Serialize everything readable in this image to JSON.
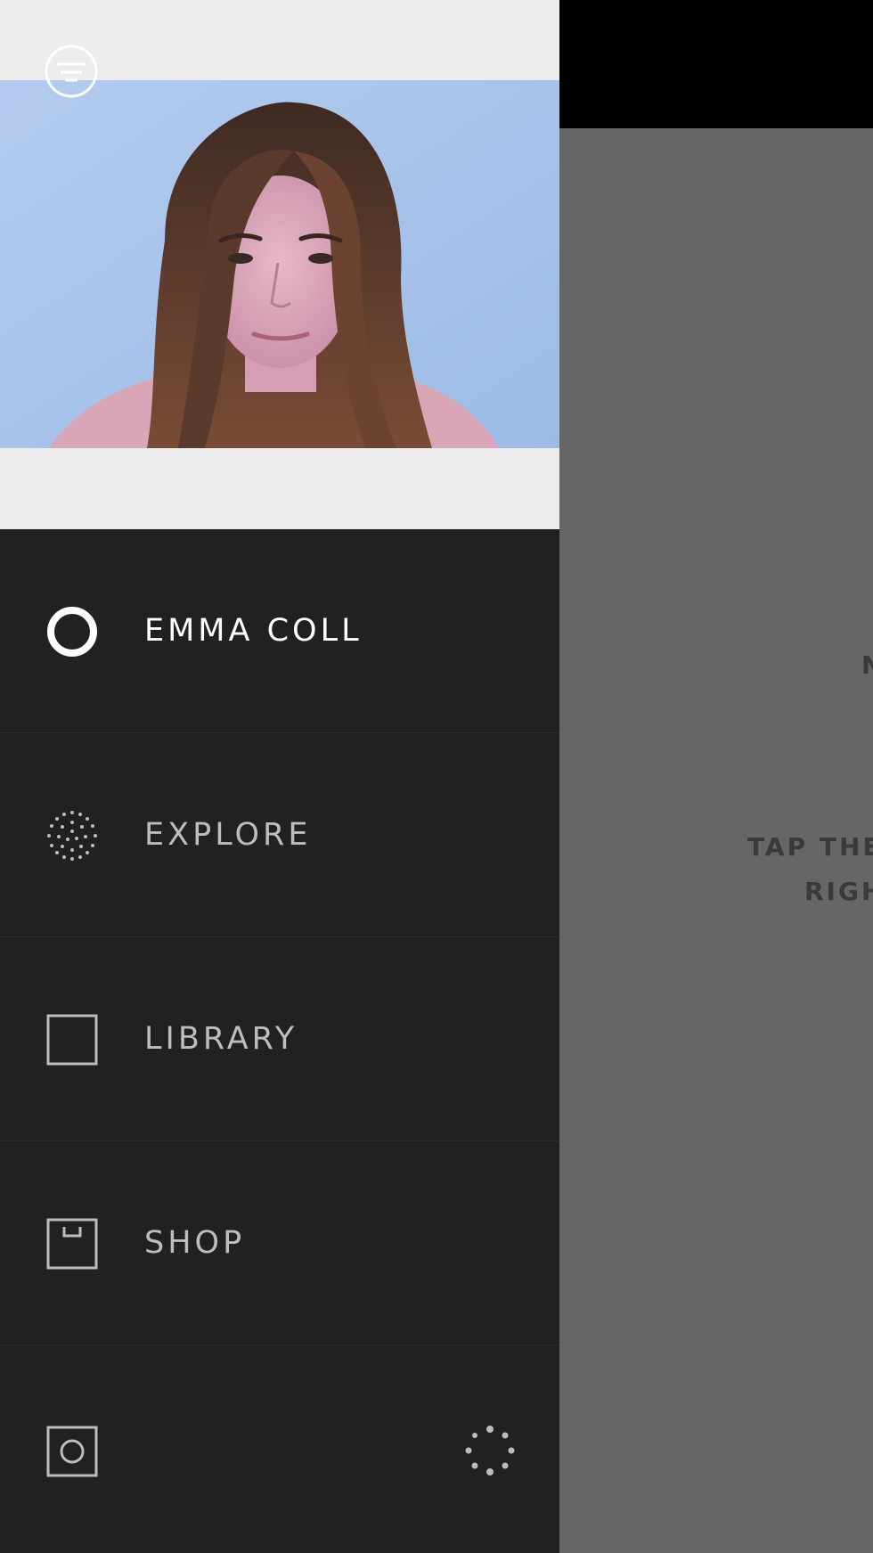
{
  "content": {
    "partial_text_1": "N",
    "partial_text_2": "TAP THE",
    "partial_text_3": "RIGH"
  },
  "drawer": {
    "menu_icon": "menu-filter-icon",
    "profile_photo_icon": "profile-photo",
    "nav": [
      {
        "label": "EMMA COLL",
        "icon": "profile-ring-icon",
        "active": true
      },
      {
        "label": "EXPLORE",
        "icon": "dotted-sphere-icon",
        "active": false
      },
      {
        "label": "LIBRARY",
        "icon": "square-outline-icon",
        "active": false
      },
      {
        "label": "SHOP",
        "icon": "shop-box-icon",
        "active": false
      }
    ],
    "footer": {
      "camera_icon": "camera-icon",
      "sync_icon": "loading-dots-icon"
    }
  },
  "colors": {
    "drawer_bg": "#212121",
    "header_bg": "#ececec",
    "photo_bg": "#a9c4ea",
    "content_bg": "#666666",
    "topbar_bg": "#000000",
    "active_text": "#ffffff",
    "inactive_text": "#bdbdbd"
  }
}
